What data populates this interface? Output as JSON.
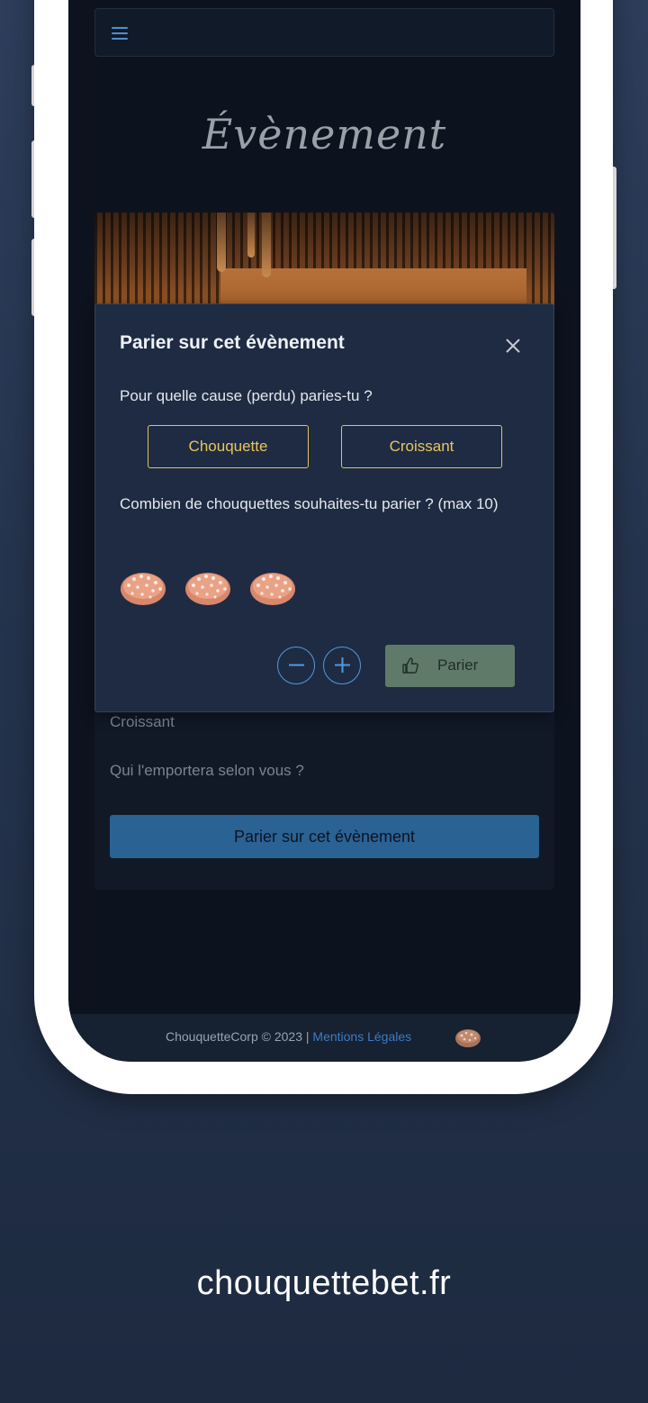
{
  "page": {
    "title": "Évènement"
  },
  "event_card": {
    "option_visible": "Croissant",
    "question": "Qui l'emportera selon vous ?",
    "bet_button_label": "Parier sur cet évènement"
  },
  "modal": {
    "title": "Parier sur cet évènement",
    "cause_question": "Pour quelle cause (perdu) paries-tu ?",
    "causes": [
      "Chouquette",
      "Croissant"
    ],
    "amount_question": "Combien de chouquettes souhaites-tu parier ? (max 10)",
    "chouquette_count": 3,
    "bet_label": "Parier"
  },
  "footer": {
    "copyright": "ChouquetteCorp © 2023 | ",
    "legal_link": "Mentions Légales"
  },
  "site_url": "chouquettebet.fr",
  "icons": {
    "menu": "hamburger-icon",
    "close": "close-icon",
    "minus": "minus-circle-icon",
    "plus": "plus-circle-icon",
    "like": "thumbs-up-icon"
  },
  "colors": {
    "accent_gold": "#e2c35e",
    "accent_blue": "#4d9be4",
    "primary_button": "#2a6294",
    "bet_button": "#5f7a68",
    "link": "#3d7cc4"
  }
}
